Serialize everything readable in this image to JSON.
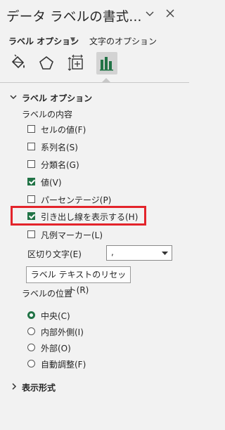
{
  "pane": {
    "title": "データ ラベルの書式...",
    "header_icons": {
      "collapse": "chevron-down-icon",
      "close": "close-icon"
    }
  },
  "tabs": {
    "label_options": "ラベル オプション",
    "text_options": "文字のオプション"
  },
  "icon_tabs": [
    "fill-line-icon",
    "effects-icon",
    "size-properties-icon",
    "label-options-icon"
  ],
  "section": {
    "title": "ラベル オプション",
    "contents_heading": "ラベルの内容",
    "checkboxes": [
      {
        "label": "セルの値(F)",
        "checked": false
      },
      {
        "label": "系列名(S)",
        "checked": false
      },
      {
        "label": "分類名(G)",
        "checked": false
      },
      {
        "label": "値(V)",
        "checked": true
      },
      {
        "label": "パーセンテージ(P)",
        "checked": false
      },
      {
        "label": "引き出し線を表示する(H)",
        "checked": true
      },
      {
        "label": "凡例マーカー(L)",
        "checked": false
      }
    ],
    "separator_label": "区切り文字(E)",
    "separator_value": ",",
    "reset_button": "ラベル テキストのリセット(R)",
    "position_heading": "ラベルの位置",
    "positions": [
      {
        "label": "中央(C)",
        "checked": true
      },
      {
        "label": "内部外側(I)",
        "checked": false
      },
      {
        "label": "外部(O)",
        "checked": false
      },
      {
        "label": "自動調整(F)",
        "checked": false
      }
    ]
  },
  "collapsed_section": {
    "title": "表示形式"
  },
  "accent_color": "#217346",
  "highlight_color": "#e3242b"
}
